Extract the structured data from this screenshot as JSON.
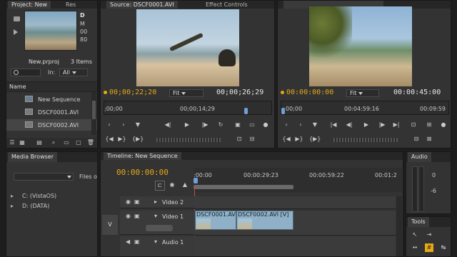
{
  "project": {
    "tabs": [
      "Project: New",
      "Res"
    ],
    "clip_name": "D",
    "clip_info": [
      "M",
      "00",
      "80"
    ],
    "filename": "New.prproj",
    "item_count": "3 Items",
    "in_label": "In:",
    "in_value": "All",
    "name_header": "Name",
    "items": [
      "New Sequence",
      "DSCF0001.AVI",
      "DSCF0002.AVI"
    ]
  },
  "source": {
    "tabs": [
      "Source: DSCF0001.AVI",
      "Effect Controls"
    ],
    "timecode_current": "00;00;22;20",
    "fit": "Fit",
    "timecode_duration": "00;00;26;29",
    "ruler_start": ";00;00",
    "ruler_mid": "00;00;14;29"
  },
  "program": {
    "timecode_current": "00:00:00:00",
    "fit": "Fit",
    "timecode_duration": "00:00:45:00",
    "ruler_start": "00;00",
    "ruler_mid": "00:04:59:16",
    "ruler_end": "00:09:59"
  },
  "media_browser": {
    "tab": "Media Browser",
    "files_label": "Files o",
    "drives": [
      "C: (VistaOS)",
      "D: (DATA)"
    ]
  },
  "timeline": {
    "tab": "Timeline: New Sequence",
    "timecode": "00:00:00:00",
    "ruler_labels": [
      ":00:00",
      "00:00:29:23",
      "00:00:59:22",
      "00:01:2"
    ],
    "tracks": [
      {
        "name": "Video 2"
      },
      {
        "name": "Video 1"
      },
      {
        "name": "Audio 1"
      }
    ],
    "target_label": "V",
    "clips": [
      "DSCF0001.AVI",
      "DSCF0002.AVI [V]"
    ]
  },
  "audio": {
    "tab": "Audio",
    "meter_labels": [
      "0",
      "-6"
    ]
  },
  "tools": {
    "tab": "Tools"
  },
  "colors": {
    "accent": "#e6a817",
    "clip": "#8fb0c6",
    "playhead": "#d64040",
    "panel": "#333333"
  }
}
